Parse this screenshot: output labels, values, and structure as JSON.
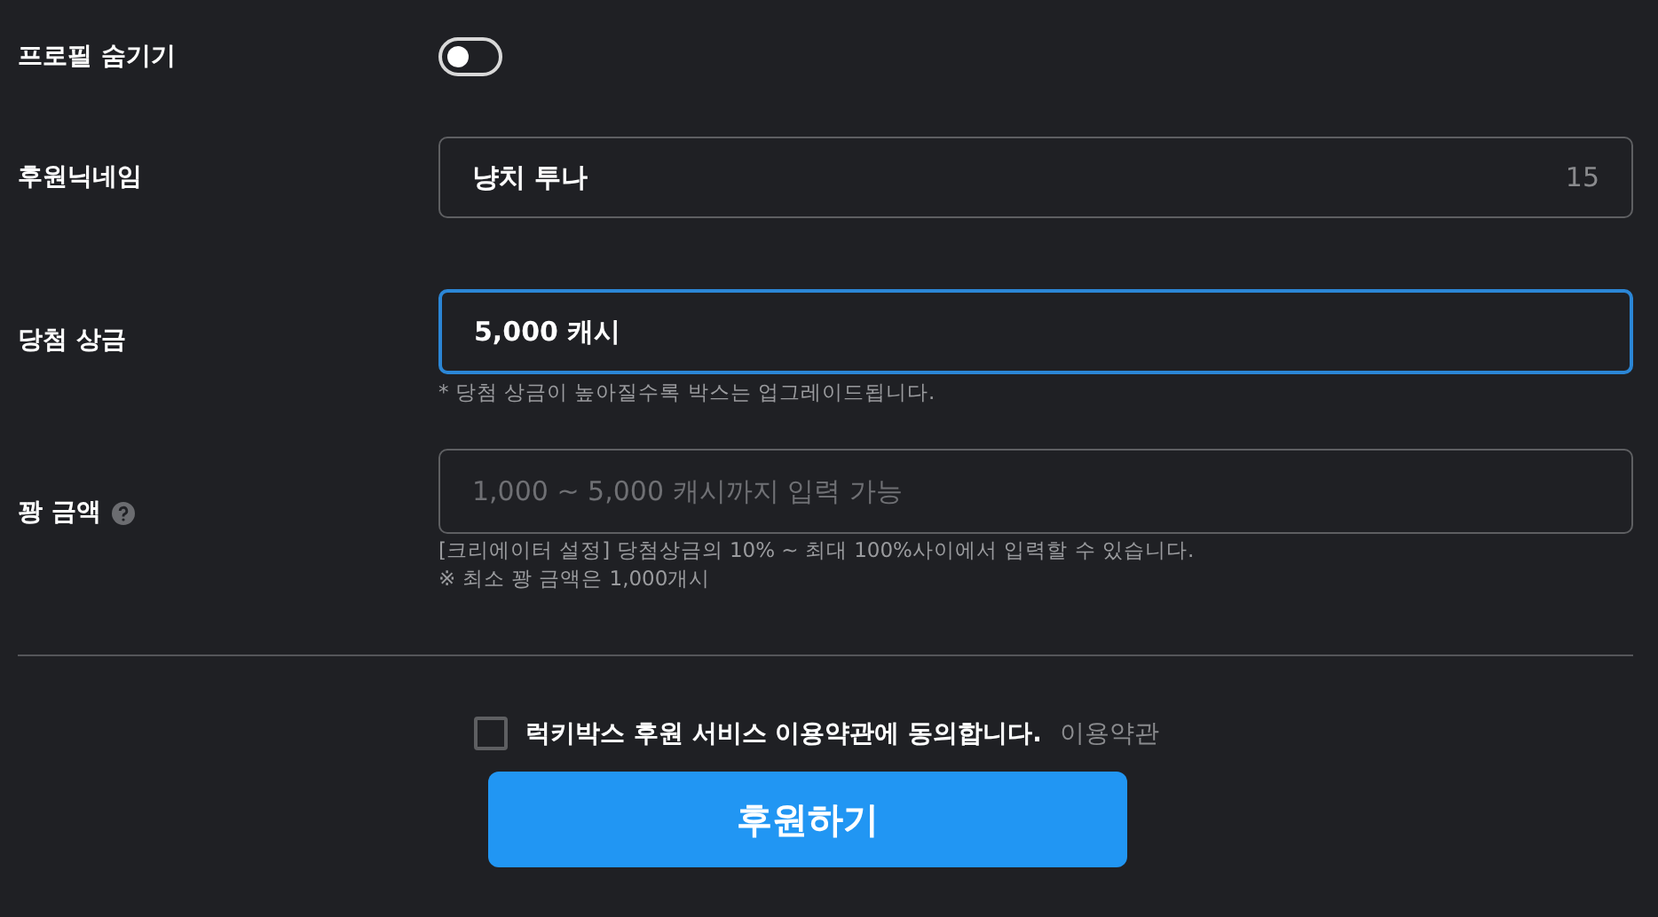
{
  "profile_hide": {
    "label": "프로필 숨기기",
    "on": false
  },
  "nickname": {
    "label": "후원닉네임",
    "value": "냥치 투나",
    "counter": "15",
    "focused": false
  },
  "prize": {
    "label": "당첨 상금",
    "value": "5,000 캐시",
    "focused": true,
    "hints": [
      "* 당첨 상금이 높아질수록 박스는 업그레이드됩니다."
    ]
  },
  "miss_amount": {
    "label": "꽝 금액",
    "help_icon": true,
    "placeholder": "1,000 ~ 5,000 캐시까지 입력 가능",
    "focused": false,
    "hints": [
      "[크리에이터 설정] 당첨상금의 10% ~ 최대 100%사이에서 입력할 수 있습니다.",
      "※ 최소 꽝 금액은 1,000개시"
    ]
  },
  "agreement": {
    "text": "럭키박스 후원 서비스 이용약관에 동의합니다.",
    "checked": false,
    "link": "이용약관"
  },
  "submit_button": "후원하기"
}
